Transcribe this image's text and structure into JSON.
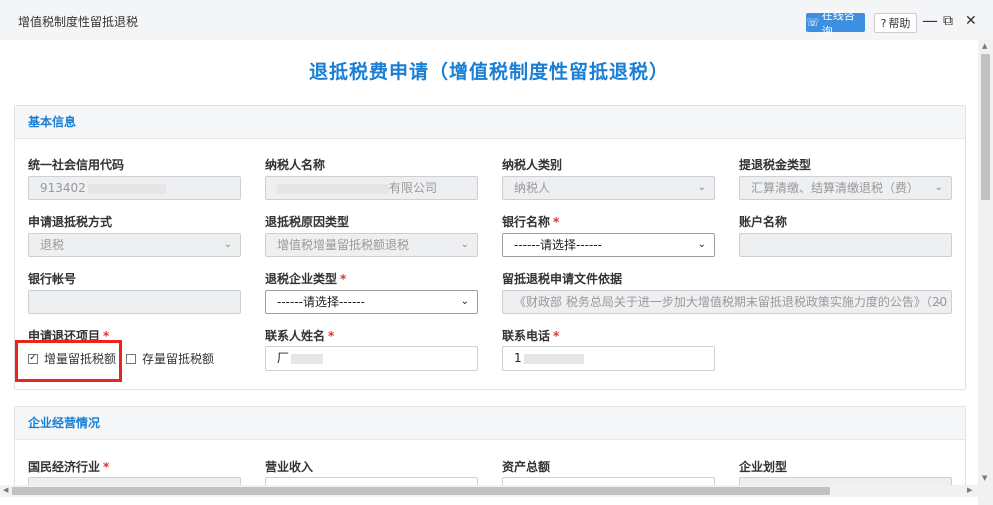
{
  "window": {
    "title": "增值税制度性留抵退税",
    "consult_label": "在线咨询",
    "help_label": "帮助",
    "minimize_glyph": "—",
    "maximize_glyph": "⧉",
    "close_glyph": "✕"
  },
  "page": {
    "title": "退抵税费申请（增值税制度性留抵退税）"
  },
  "basic_info": {
    "heading": "基本信息",
    "credit_code": {
      "label": "统一社会信用代码",
      "value": "913402"
    },
    "taxpayer_name": {
      "label": "纳税人名称",
      "value": "有限公司"
    },
    "taxpayer_type": {
      "label": "纳税人类别",
      "value": "纳税人"
    },
    "refund_type": {
      "label": "提退税金类型",
      "value": "汇算清缴、结算清缴退税（费）"
    },
    "refund_method": {
      "label": "申请退抵税方式",
      "value": "退税"
    },
    "reason_type": {
      "label": "退抵税原因类型",
      "value": "增值税增量留抵税额退税"
    },
    "bank_name": {
      "label": "银行名称",
      "value": "------请选择------"
    },
    "account_name": {
      "label": "账户名称",
      "value": ""
    },
    "bank_account": {
      "label": "银行帐号",
      "value": ""
    },
    "enterprise_type": {
      "label": "退税企业类型",
      "value": "------请选择------"
    },
    "basis_doc": {
      "label": "留抵退税申请文件依据",
      "value": "《财政部 税务总局关于进一步加大增值税期末留抵退税政策实施力度的公告》（20"
    },
    "refund_items": {
      "label": "申请退还项目",
      "options": [
        {
          "label": "增量留抵税额",
          "checked": true
        },
        {
          "label": "存量留抵税额",
          "checked": false
        }
      ]
    },
    "contact_name": {
      "label": "联系人姓名",
      "value": "厂"
    },
    "contact_phone": {
      "label": "联系电话",
      "value": "1"
    }
  },
  "operations": {
    "heading": "企业经营情况",
    "industry": {
      "label": "国民经济行业"
    },
    "revenue": {
      "label": "营业收入"
    },
    "total_assets": {
      "label": "资产总额"
    },
    "enterprise_scale": {
      "label": "企业划型"
    }
  },
  "required_mark": "*",
  "colors": {
    "accent": "#1a7fd4",
    "consult_button": "#3d8fe0",
    "required": "#e03030",
    "highlight": "#e8261f"
  }
}
